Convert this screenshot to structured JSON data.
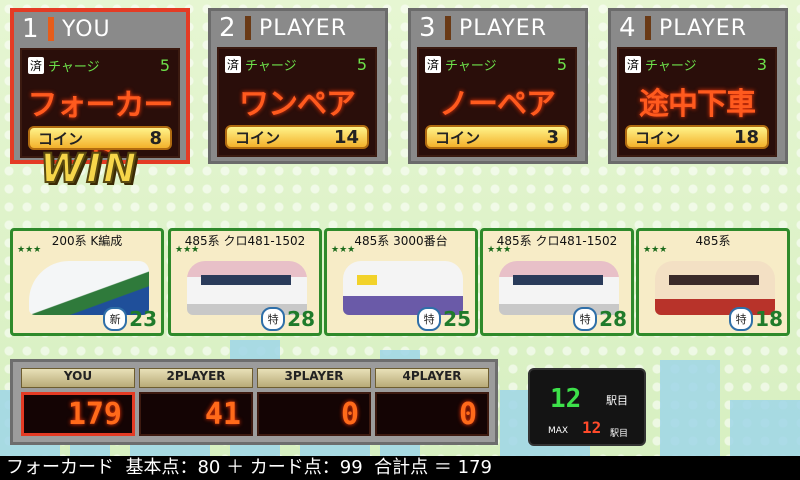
{
  "players": [
    {
      "num": "1",
      "name": "YOU",
      "charge_label": "チャージ",
      "sumi": "済",
      "charge": "5",
      "hand": "フォーカード",
      "coin_label": "コイン",
      "coins": "8"
    },
    {
      "num": "2",
      "name": "PLAYER",
      "charge_label": "チャージ",
      "sumi": "済",
      "charge": "5",
      "hand": "ワンペア",
      "coin_label": "コイン",
      "coins": "14"
    },
    {
      "num": "3",
      "name": "PLAYER",
      "charge_label": "チャージ",
      "sumi": "済",
      "charge": "5",
      "hand": "ノーペア",
      "coin_label": "コイン",
      "coins": "3"
    },
    {
      "num": "4",
      "name": "PLAYER",
      "charge_label": "チャージ",
      "sumi": "済",
      "charge": "3",
      "hand": "途中下車",
      "coin_label": "コイン",
      "coins": "18"
    }
  ],
  "win_text": "WIN",
  "cards": [
    {
      "name": "200系 K編成",
      "tag": "新",
      "points": "23",
      "body": "#e9eef0",
      "stripe": "#2f7a3b"
    },
    {
      "name": "485系 クロ481-1502",
      "tag": "特",
      "points": "28",
      "body": "#f2f2f2",
      "stripe": "#e6a8b5"
    },
    {
      "name": "485系 3000番台",
      "tag": "特",
      "points": "25",
      "body": "#f0f0f0",
      "stripe": "#6a5aa8"
    },
    {
      "name": "485系 クロ481-1502",
      "tag": "特",
      "points": "28",
      "body": "#f2f2f2",
      "stripe": "#e6a8b5"
    },
    {
      "name": "485系",
      "tag": "特",
      "points": "18",
      "body": "#f3e0c4",
      "stripe": "#b8332a"
    }
  ],
  "scoreboard": [
    {
      "label": "YOU",
      "value": "179"
    },
    {
      "label": "2PLAYER",
      "value": "41"
    },
    {
      "label": "3PLAYER",
      "value": "0"
    },
    {
      "label": "4PLAYER",
      "value": "0"
    }
  ],
  "station": {
    "count": "12",
    "unit": "駅目",
    "max_label": "MAX",
    "max_count": "12",
    "max_unit": "駅目"
  },
  "summary": "フォーカード  基本点：80 ＋ カード点：99  合計点 ＝ 179"
}
